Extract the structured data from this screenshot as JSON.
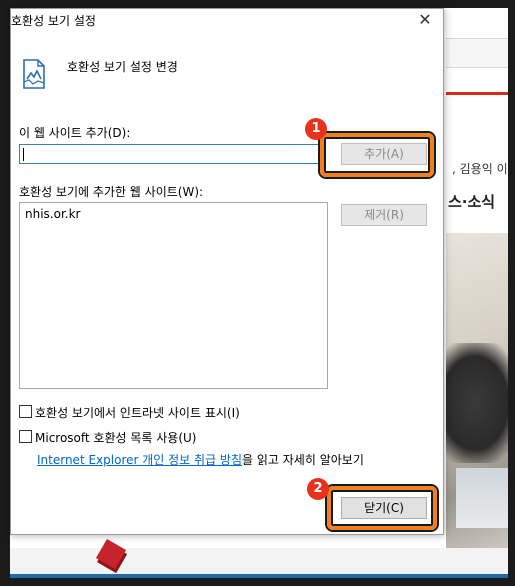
{
  "background": {
    "snippet_text": ", 김용익 이사",
    "heading_text": "스·소식"
  },
  "dialog": {
    "title": "호환성 보기 설정",
    "close_glyph": "✕",
    "header": "호환성 보기 설정 변경",
    "add_label": "이 웹 사이트 추가(D):",
    "add_input_value": "",
    "add_button": "추가(A)",
    "list_label": "호환성 보기에 추가한 웹 사이트(W):",
    "sites": [
      "nhis.or.kr"
    ],
    "remove_button": "제거(R)",
    "checkbox_intranet": "호환성 보기에서 인트라넷 사이트 표시(I)",
    "checkbox_ms_list": "Microsoft 호환성 목록 사용(U)",
    "info_link": "Internet Explorer 개인 정보 취급 방침",
    "info_suffix": "을 읽고 자세히 알아보기",
    "close_button": "닫기(C)"
  },
  "annotations": {
    "badge_1": "1",
    "badge_2": "2",
    "highlight_color": "#f0801e",
    "badge_color": "#e8321e"
  },
  "icons": {
    "header_icon": "broken-page-icon",
    "close_icon": "close-icon"
  }
}
